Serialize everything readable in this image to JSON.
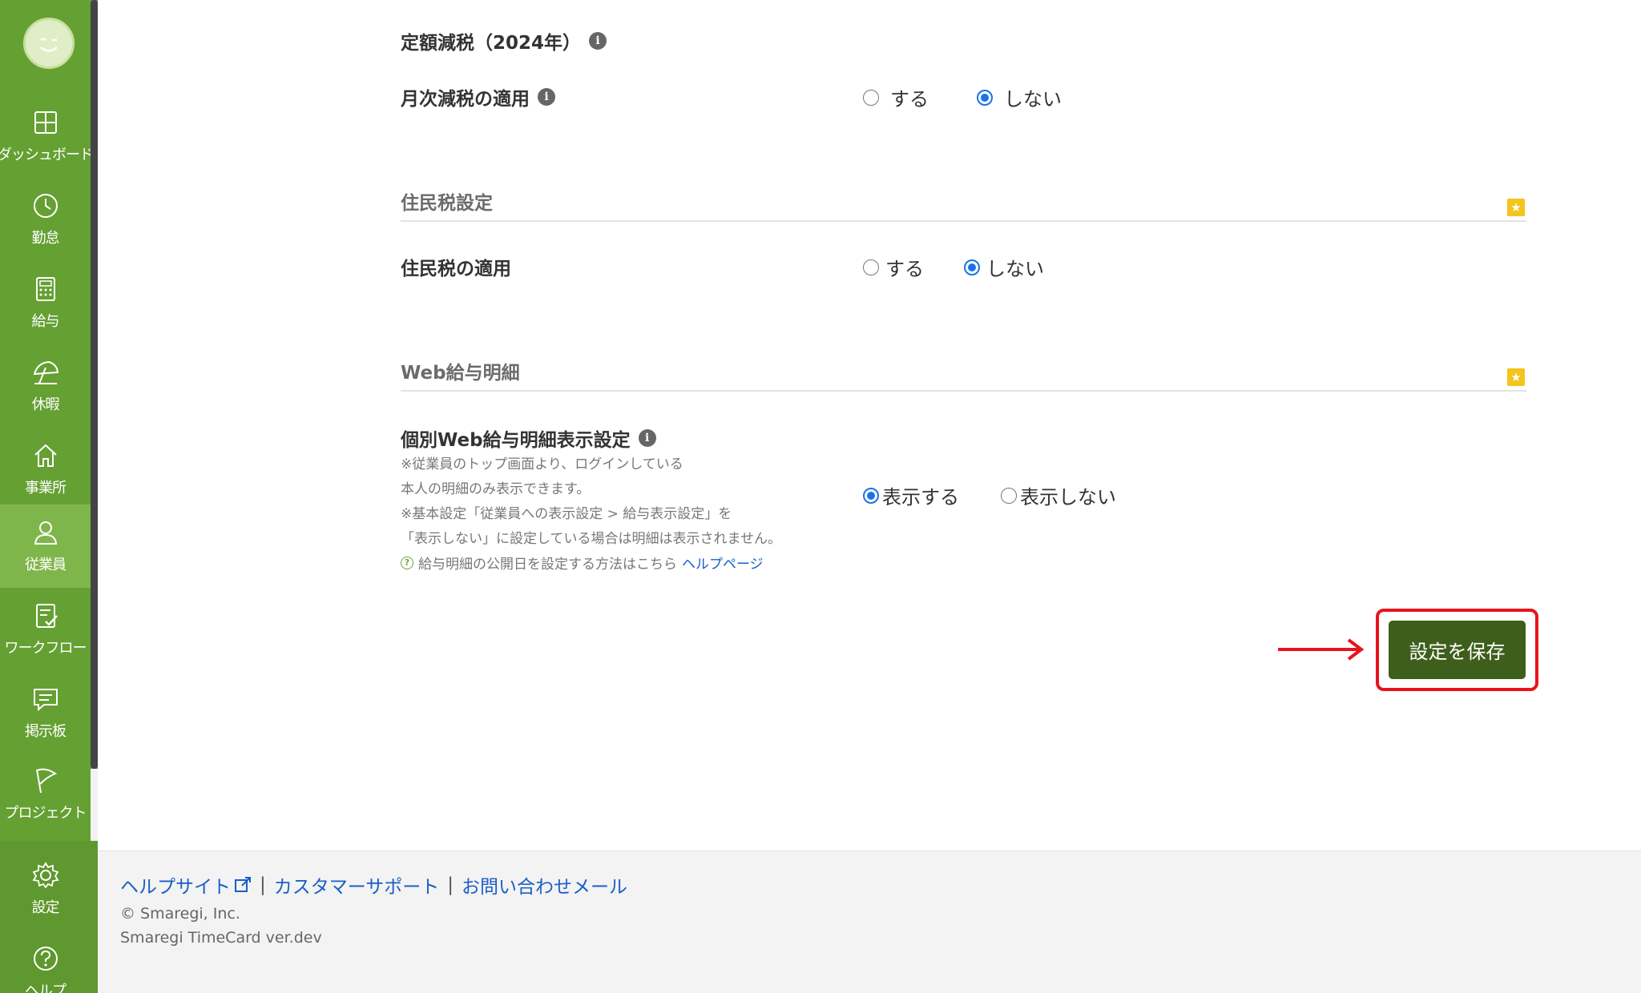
{
  "sidebar": {
    "items": [
      {
        "label": "ダッシュボード",
        "icon": "dashboard-icon"
      },
      {
        "label": "勤怠",
        "icon": "clock-icon"
      },
      {
        "label": "給与",
        "icon": "calculator-icon"
      },
      {
        "label": "休暇",
        "icon": "umbrella-icon"
      },
      {
        "label": "事業所",
        "icon": "home-icon"
      },
      {
        "label": "従業員",
        "icon": "user-icon"
      },
      {
        "label": "ワークフロー",
        "icon": "clipboard-check-icon"
      },
      {
        "label": "掲示板",
        "icon": "message-icon"
      },
      {
        "label": "プロジェクト",
        "icon": "flag-icon"
      },
      {
        "label": "設定",
        "icon": "gear-icon"
      },
      {
        "label": "ヘルプ",
        "icon": "help-icon"
      }
    ],
    "active": "従業員",
    "accent_color": "#65a033"
  },
  "fixed_tax": {
    "heading": "定額減税（2024年）",
    "monthly_label": "月次減税の適用",
    "options": [
      "する",
      "しない"
    ],
    "selected": "しない"
  },
  "resident_tax": {
    "section_title": "住民税設定",
    "label": "住民税の適用",
    "options": [
      "する",
      "しない"
    ],
    "selected": "しない"
  },
  "web_payslip": {
    "section_title": "Web給与明細",
    "label": "個別Web給与明細表示設定",
    "notes": [
      "※従業員のトップ画面より、ログインしている",
      "本人の明細のみ表示できます。",
      "※基本設定「従業員への表示設定 > 給与表示設定」を",
      "「表示しない」に設定している場合は明細は表示されません。"
    ],
    "help_text": "給与明細の公開日を設定する方法はこちら",
    "help_link": "ヘルプページ",
    "options": [
      "表示する",
      "表示しない"
    ],
    "selected": "表示する"
  },
  "save_button": {
    "label": "設定を保存",
    "color": "#3e5e1b",
    "highlight_color": "#e8131c"
  },
  "footer": {
    "help_site": "ヘルプサイト",
    "separator": "|",
    "customer_support": "カスタマーサポート",
    "contact_mail": "お問い合わせメール",
    "copyright": "© Smaregi, Inc.",
    "version": "Smaregi TimeCard ver.dev"
  }
}
